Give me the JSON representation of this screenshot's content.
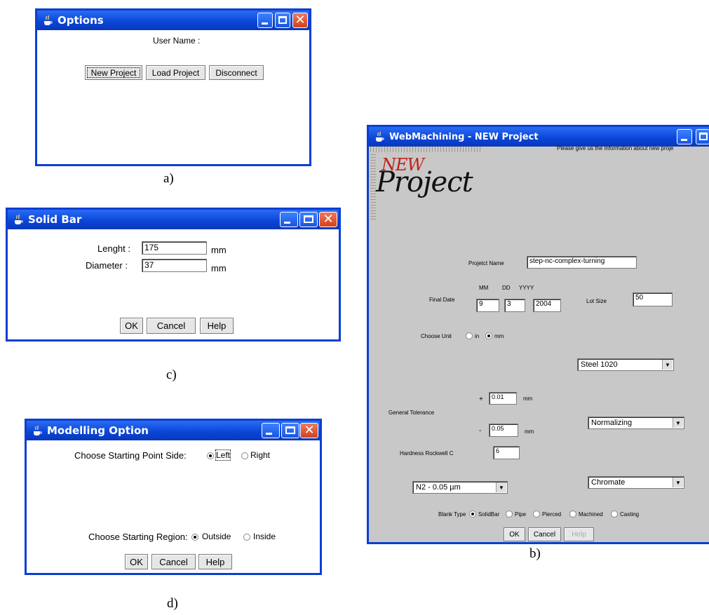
{
  "options": {
    "title": "Options",
    "user_name_label": "User Name :",
    "new_project": "New Project",
    "load_project": "Load Project",
    "disconnect": "Disconnect",
    "caption": "a)"
  },
  "solid_bar": {
    "title": "Solid Bar",
    "length_label": "Lenght :",
    "length_value": "175",
    "diameter_label": "Diameter :",
    "diameter_value": "37",
    "unit1": "mm",
    "unit2": "mm",
    "ok": "OK",
    "cancel": "Cancel",
    "help": "Help",
    "caption": "c)"
  },
  "modelling": {
    "title": "Modelling Option",
    "start_side_label": "Choose Starting Point Side:",
    "left": "Left",
    "right": "Right",
    "start_region_label": "Choose Starting Region:",
    "outside": "Outside",
    "inside": "Inside",
    "ok": "OK",
    "cancel": "Cancel",
    "help": "Help",
    "caption": "d)"
  },
  "new_project": {
    "title": "WebMachining - NEW Project",
    "info_text": "Please give us the information about new proje",
    "logo_new": "NEW",
    "logo_project": "Project",
    "project_name_label": "Projetct Name",
    "project_name_value": "step-nc-complex-turning",
    "mm_label": "MM",
    "dd_label": "DD",
    "yyyy_label": "YYYY",
    "final_date_label": "Final Date",
    "month": "9",
    "day": "3",
    "year": "2004",
    "lot_size_label": "Lot Size",
    "lot_size_value": "50",
    "choose_unit_label": "Choose Unit",
    "unit_in": "in",
    "unit_mm": "mm",
    "material_value": "Steel 1020",
    "plus": "+",
    "tol_plus_value": "0.01",
    "tol_plus_unit": "mm",
    "general_tolerance_label": "General Tolerance",
    "minus": "-",
    "tol_minus_value": "0.05",
    "tol_minus_unit": "mm",
    "heat_treatment_value": "Normalizing",
    "hardness_label": "Hardness Rockwell C",
    "hardness_value": "6",
    "surface_value": "Chromate",
    "roughness_value": "N2 - 0.05 µm",
    "blank_type_label": "Blank Type",
    "blank_types": [
      "SolidBar",
      "Pipe",
      "Pierced",
      "Machined",
      "Casting"
    ],
    "ok": "OK",
    "cancel": "Cancel",
    "help": "Help",
    "caption": "b)"
  }
}
